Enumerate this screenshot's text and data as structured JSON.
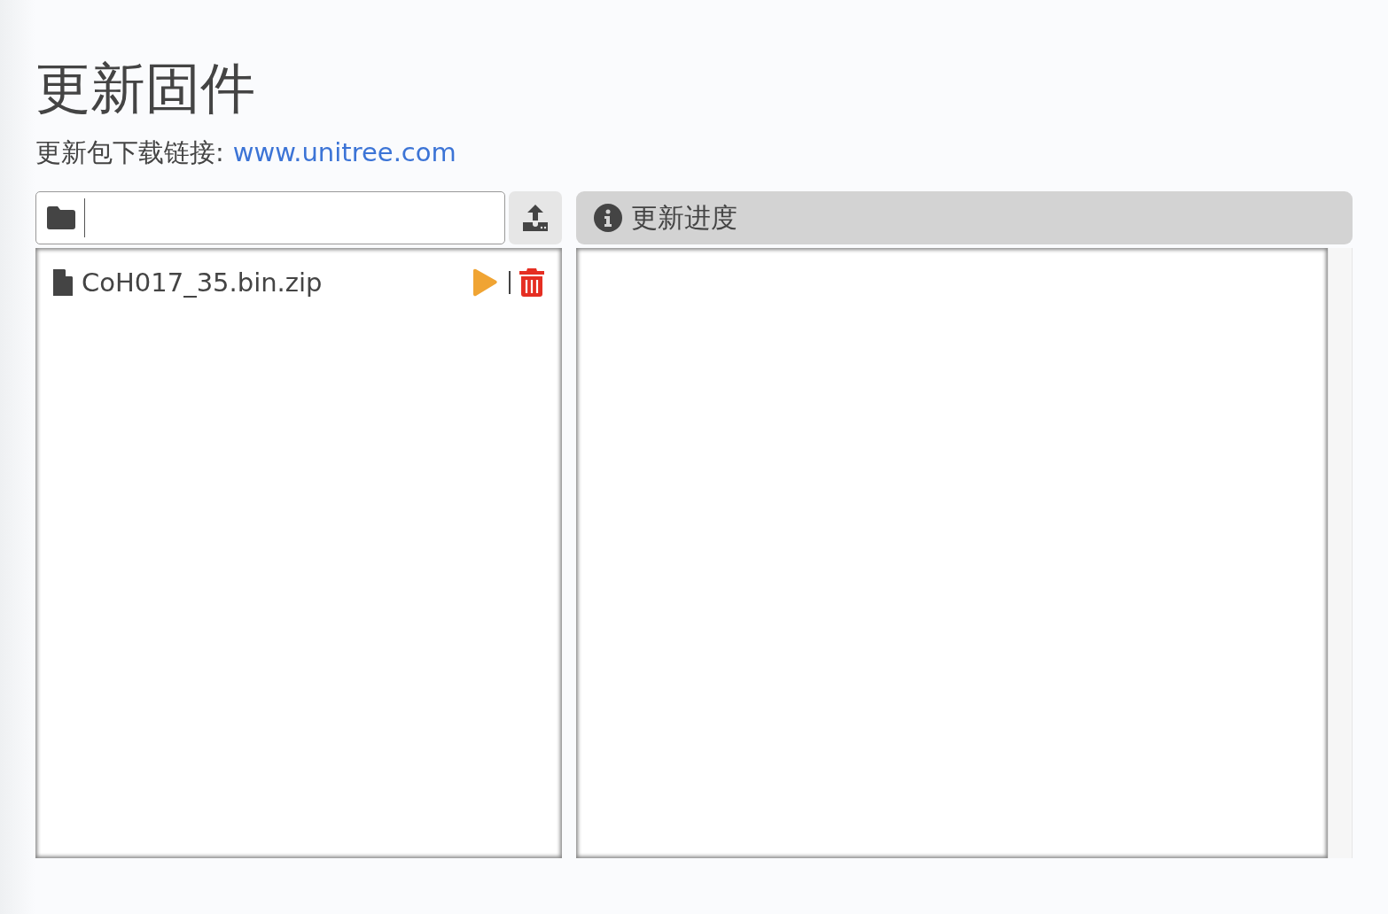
{
  "title": "更新固件",
  "download": {
    "label": "更新包下载链接:",
    "link": "www.unitree.com"
  },
  "files": [
    {
      "name": "CoH017_35.bin.zip"
    }
  ],
  "progress": {
    "title": "更新进度"
  }
}
